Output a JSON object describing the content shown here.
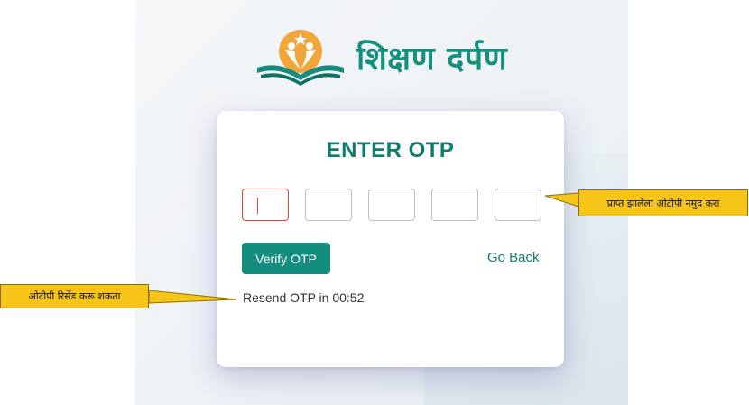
{
  "brand": {
    "name": "शिक्षण दर्पण",
    "logo_icon": "open-book-star-icon"
  },
  "otp_form": {
    "title": "ENTER OTP",
    "digits": [
      "",
      "",
      "",
      "",
      ""
    ],
    "verify_label": "Verify OTP",
    "go_back_label": "Go Back",
    "resend_text": "Resend OTP in 00:52"
  },
  "annotations": {
    "otp_hint": "प्राप्त झालेला ओटीपी नमुद करा",
    "resend_hint": "ओटीपी रिसेंड करू शकता"
  },
  "colors": {
    "accent": "#148d7e",
    "brand_orange": "#f0a63a",
    "callout": "#f7c517",
    "active_border": "#dd4a3c"
  }
}
